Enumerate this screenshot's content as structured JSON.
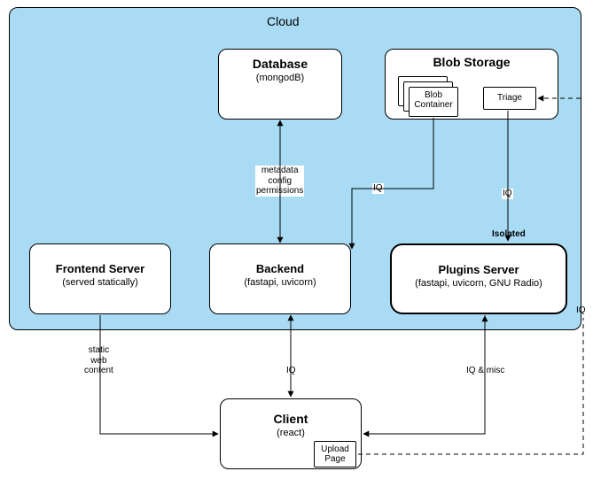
{
  "diagram": {
    "cloud_title": "Cloud",
    "nodes": {
      "database": {
        "title": "Database",
        "sub": "(mongodB)"
      },
      "blob_storage": {
        "title": "Blob Storage"
      },
      "blob_container": {
        "label": "Blob\nContainer"
      },
      "triage": {
        "label": "Triage"
      },
      "frontend": {
        "title": "Frontend Server",
        "sub": "(served statically)"
      },
      "backend": {
        "title": "Backend",
        "sub": "(fastapi, uvicorn)"
      },
      "plugins": {
        "title": "Plugins Server",
        "sub": "(fastapi, uvicorn, GNU Radio)"
      },
      "plugins_tag": "Isolated",
      "client": {
        "title": "Client",
        "sub": "(react)"
      },
      "upload_page": {
        "label": "Upload\nPage"
      }
    },
    "edges": {
      "db_backend": "metadata\nconfig\npermissions",
      "blob_backend_iq": "IQ",
      "blob_plugins_iq": "IQ",
      "frontend_client": "static\nweb\ncontent",
      "backend_client_iq": "IQ",
      "plugins_client_iq": "IQ & misc",
      "triage_plugins_iq": "IQ"
    }
  }
}
